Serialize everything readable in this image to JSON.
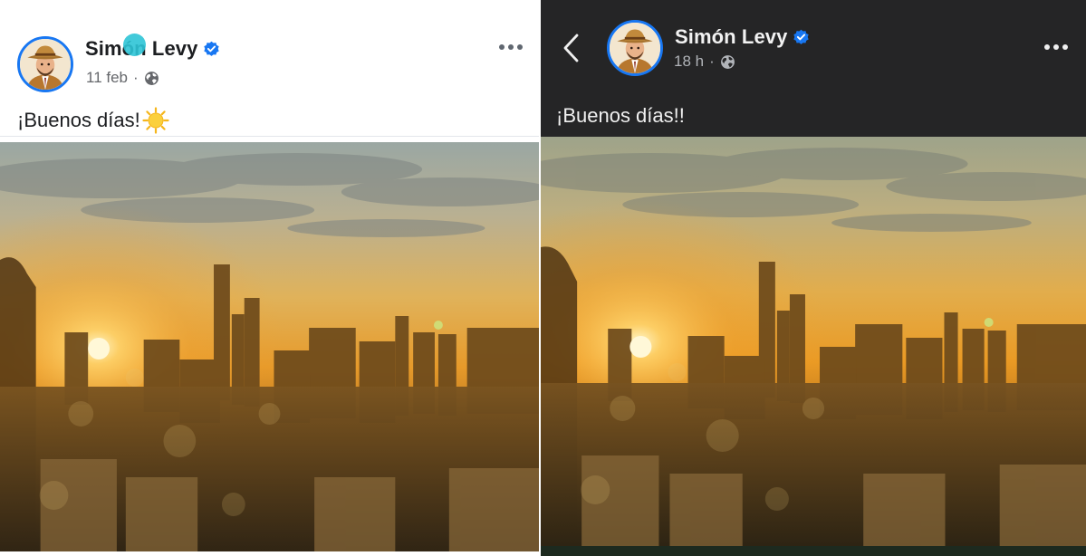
{
  "left_post": {
    "author": "Simón Levy",
    "timestamp": "11 feb",
    "separator": "·",
    "privacy_icon": "globe-icon",
    "text": "¡Buenos días!",
    "emoji": "sun-emoji",
    "verified_icon": "verified-badge-icon",
    "menu_icon": "more-options-icon"
  },
  "right_post": {
    "author": "Simón Levy",
    "timestamp": "18 h",
    "separator": "·",
    "privacy_icon": "globe-icon",
    "text": "¡Buenos días!!",
    "verified_icon": "verified-badge-icon",
    "menu_icon": "more-options-icon",
    "back_icon": "back-chevron-icon"
  },
  "colors": {
    "verified_blue": "#1877f2",
    "dark_background": "#252526",
    "light_background": "#ffffff",
    "touch_indicator": "#2ec4d6"
  }
}
